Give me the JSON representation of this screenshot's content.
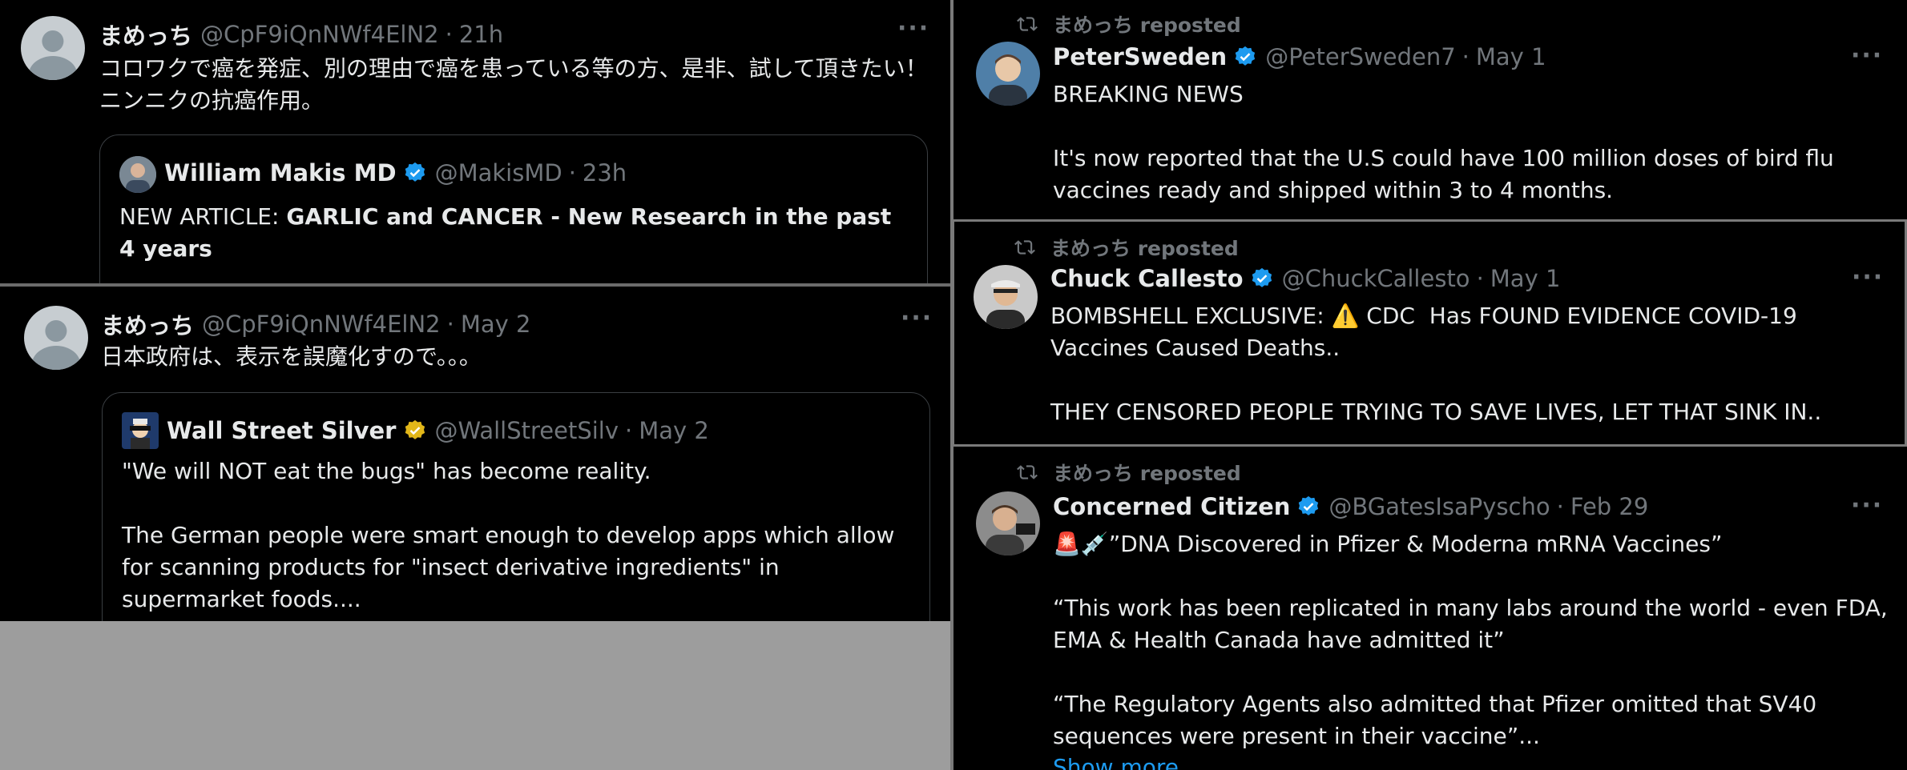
{
  "colors": {
    "background": "#000000",
    "text": "#e7e9ea",
    "muted": "#71767b",
    "verified_blue": "#1d9bf0",
    "verified_gold": "#e2b719",
    "gray_fill": "#9d9d9d"
  },
  "left_posts": [
    {
      "name": "まめっち",
      "handle": "@CpF9iQnNWf4ElN2",
      "time": "21h",
      "more": "···",
      "text": "コロワクで癌を発症、別の理由で癌を患っている等の方、是非、試して頂きたい！\nニンニクの抗癌作用。",
      "quote": {
        "name": "William Makis MD",
        "handle": "@MakisMD",
        "time": "23h",
        "text_prefix": "NEW ARTICLE: ",
        "text_bold": "GARLIC and CANCER - New Research in the past 4 years"
      }
    },
    {
      "name": "まめっち",
      "handle": "@CpF9iQnNWf4ElN2",
      "time": "May 2",
      "more": "···",
      "text": "日本政府は、表示を誤魔化すので。。。",
      "quote": {
        "name": "Wall Street Silver",
        "handle": "@WallStreetSilv",
        "time": "May 2",
        "text": "\"We will NOT eat the bugs\" has become reality.\n\nThe German people were smart enough to develop apps which allow for scanning products for \"insect derivative ingredients\" in supermarket foods...."
      }
    }
  ],
  "right_posts": [
    {
      "repost_label": "まめっち reposted",
      "name": "PeterSweden",
      "handle": "@PeterSweden7",
      "time": "May 1",
      "more": "···",
      "text": "BREAKING NEWS\n\nIt's now reported that the U.S could have 100 million doses of bird flu vaccines ready and shipped within 3 to 4 months."
    },
    {
      "repost_label": "まめっち reposted",
      "name": "Chuck Callesto",
      "handle": "@ChuckCallesto",
      "time": "May 1",
      "more": "···",
      "text": "BOMBSHELL EXCLUSIVE: ⚠️ CDC  Has FOUND EVIDENCE COVID-19 Vaccines Caused Deaths..\n\nTHEY CENSORED PEOPLE TRYING TO SAVE LIVES, LET THAT SINK IN.."
    },
    {
      "repost_label": "まめっち reposted",
      "name": "Concerned Citizen",
      "handle": "@BGatesIsaPyscho",
      "time": "Feb 29",
      "more": "···",
      "text": "🚨💉”DNA Discovered in Pfizer & Moderna mRNA Vaccines”\n\n“This work has been replicated in many labs around the world - even FDA, EMA & Health Canada have admitted it”\n\n“The Regulatory Agents also admitted that Pfizer omitted that SV40 sequences were present in their vaccine”...",
      "show_more": "Show more"
    }
  ]
}
